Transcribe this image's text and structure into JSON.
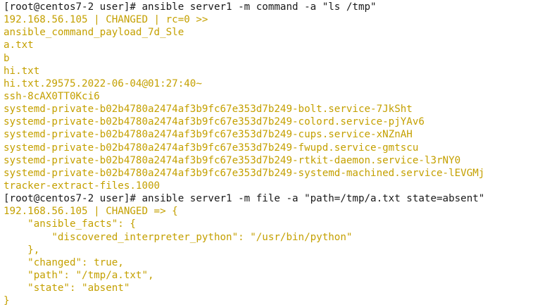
{
  "colors": {
    "background": "#ffffff",
    "command_text": "#1a1a1a",
    "output_text": "#c4a000"
  },
  "terminal": {
    "lines": [
      {
        "kind": "cmd",
        "text": "[root@centos7-2 user]# ansible server1 -m command -a \"ls /tmp\""
      },
      {
        "kind": "out",
        "text": "192.168.56.105 | CHANGED | rc=0 >>"
      },
      {
        "kind": "out",
        "text": "ansible_command_payload_7d_Sle"
      },
      {
        "kind": "out",
        "text": "a.txt"
      },
      {
        "kind": "out",
        "text": "b"
      },
      {
        "kind": "out",
        "text": "hi.txt"
      },
      {
        "kind": "out",
        "text": "hi.txt.29575.2022-06-04@01:27:40~"
      },
      {
        "kind": "out",
        "text": "ssh-8cAX0TT0Kci6"
      },
      {
        "kind": "out",
        "text": "systemd-private-b02b4780a2474af3b9fc67e353d7b249-bolt.service-7JkSht"
      },
      {
        "kind": "out",
        "text": "systemd-private-b02b4780a2474af3b9fc67e353d7b249-colord.service-pjYAv6"
      },
      {
        "kind": "out",
        "text": "systemd-private-b02b4780a2474af3b9fc67e353d7b249-cups.service-xNZnAH"
      },
      {
        "kind": "out",
        "text": "systemd-private-b02b4780a2474af3b9fc67e353d7b249-fwupd.service-gmtscu"
      },
      {
        "kind": "out",
        "text": "systemd-private-b02b4780a2474af3b9fc67e353d7b249-rtkit-daemon.service-l3rNY0"
      },
      {
        "kind": "out",
        "text": "systemd-private-b02b4780a2474af3b9fc67e353d7b249-systemd-machined.service-lEVGMj"
      },
      {
        "kind": "out",
        "text": "tracker-extract-files.1000"
      },
      {
        "kind": "cmd",
        "text": "[root@centos7-2 user]# ansible server1 -m file -a \"path=/tmp/a.txt state=absent\""
      },
      {
        "kind": "out",
        "text": "192.168.56.105 | CHANGED => {"
      },
      {
        "kind": "out",
        "text": "    \"ansible_facts\": {"
      },
      {
        "kind": "out",
        "text": "        \"discovered_interpreter_python\": \"/usr/bin/python\""
      },
      {
        "kind": "out",
        "text": "    },"
      },
      {
        "kind": "out",
        "text": "    \"changed\": true,"
      },
      {
        "kind": "out",
        "text": "    \"path\": \"/tmp/a.txt\","
      },
      {
        "kind": "out",
        "text": "    \"state\": \"absent\""
      },
      {
        "kind": "out",
        "text": "}"
      }
    ]
  }
}
